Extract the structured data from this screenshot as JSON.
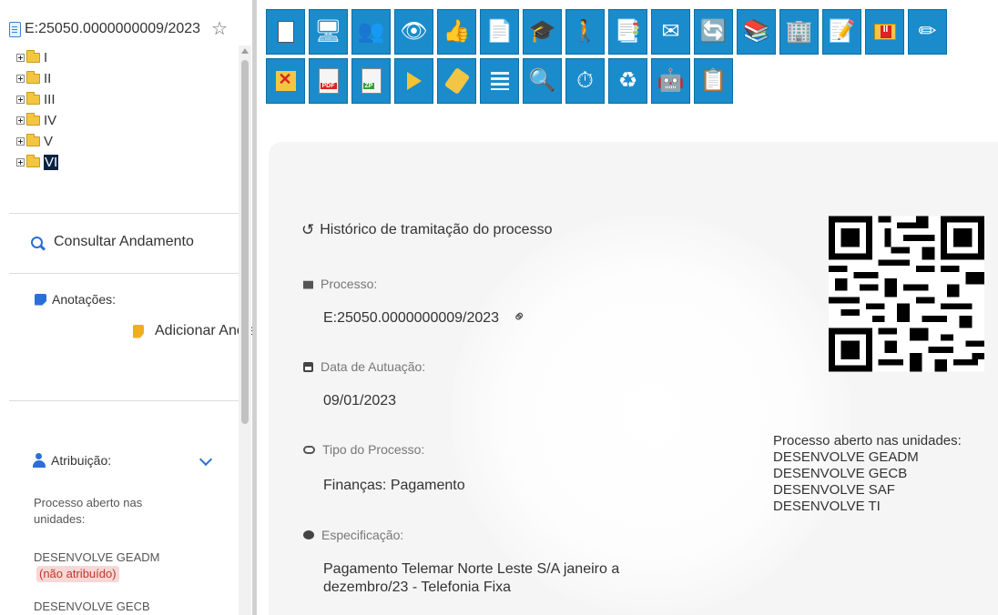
{
  "process_number": "E:25050.0000000009/2023",
  "tree": {
    "items": [
      {
        "label": "I",
        "selected": false
      },
      {
        "label": "II",
        "selected": false
      },
      {
        "label": "III",
        "selected": false
      },
      {
        "label": "IV",
        "selected": false
      },
      {
        "label": "V",
        "selected": false
      },
      {
        "label": "VI",
        "selected": true
      }
    ]
  },
  "sidebar": {
    "consult_label": "Consultar Andamento",
    "annotations_label": "Anotações:",
    "add_note_label": "Adicionar Anotações",
    "attribution_label": "Atribuição:",
    "open_units_label": "Processo aberto nas unidades:",
    "units": [
      {
        "name": "DESENVOLVE GEADM",
        "status": "(não atribuído)"
      },
      {
        "name": "DESENVOLVE GECB",
        "status": ""
      }
    ]
  },
  "toolbar": {
    "row1": [
      "new-document-icon",
      "web-icon",
      "people-icon",
      "eye-icon",
      "thumbs-up-icon",
      "letter-icon",
      "stamp-icon",
      "person-folder-icon",
      "move-docs-icon",
      "email-icon",
      "refresh-icon",
      "books-icon",
      "building-icon",
      "note-icon",
      "pause-folder-icon",
      "edit-icon"
    ],
    "row2": [
      "remove-folder-icon",
      "pdf-icon",
      "zip-icon",
      "flag-icon",
      "tag-icon",
      "list-icon",
      "search-icon",
      "clock-icon",
      "reload-docs-icon",
      "robot-icon",
      "checklist-icon"
    ],
    "pdf_label": "PDF",
    "zip_label": "ZP"
  },
  "main": {
    "history_link": "Histórico de tramitação do processo",
    "fields": {
      "process_label": "Processo:",
      "process_value": "E:25050.0000000009/2023",
      "date_label": "Data de Autuação:",
      "date_value": "09/01/2023",
      "type_label": "Tipo do Processo:",
      "type_value": "Finanças: Pagamento",
      "spec_label": "Especificação:",
      "spec_value": "Pagamento Telemar Norte Leste S/A janeiro a dezembro/23 - Telefonia Fixa"
    },
    "open_units_title": "Processo aberto nas unidades:",
    "open_units": [
      "DESENVOLVE GEADM",
      "DESENVOLVE GECB",
      "DESENVOLVE SAF",
      "DESENVOLVE TI"
    ]
  }
}
